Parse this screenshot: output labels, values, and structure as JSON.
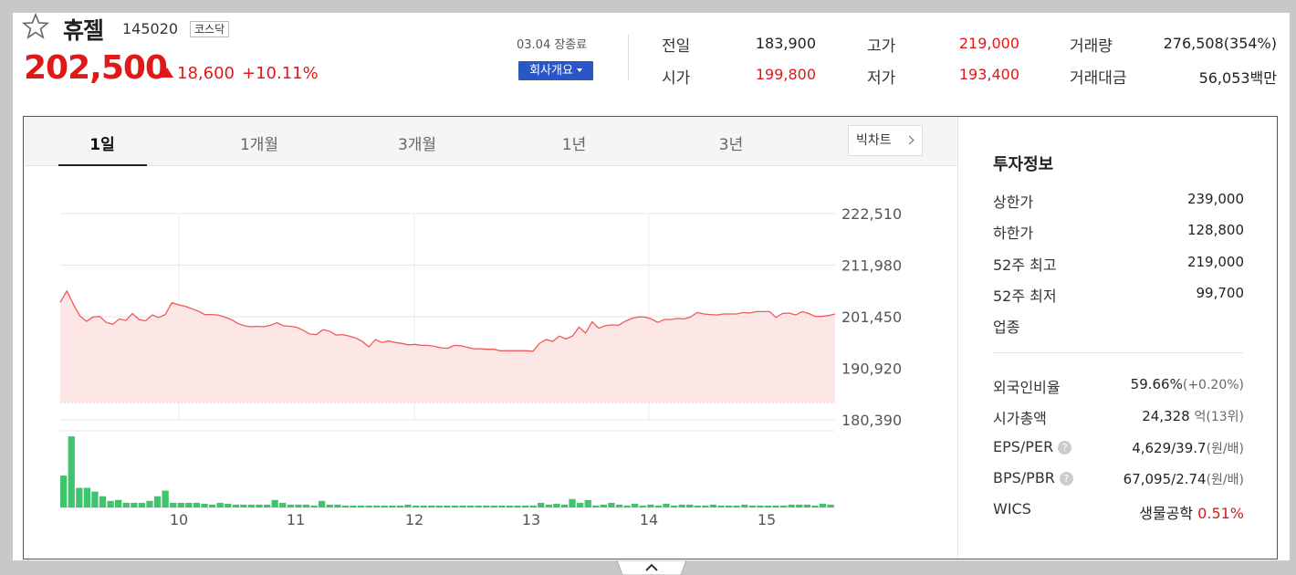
{
  "stock": {
    "name": "휴젤",
    "code": "145020",
    "market": "코스닥",
    "price": "202,500",
    "change": "18,600",
    "change_pct": "+10.11%",
    "date_status": "03.04 장종료",
    "company_button": "회사개요"
  },
  "quotes": [
    {
      "label": "전일",
      "value": "183,900"
    },
    {
      "label": "고가",
      "value": "219,000"
    },
    {
      "label": "거래량",
      "value": "276,508(354%)"
    },
    {
      "label": "시가",
      "value": "199,800"
    },
    {
      "label": "저가",
      "value": "193,400"
    },
    {
      "label": "거래대금",
      "value": "56,053백만"
    }
  ],
  "tabs": [
    "1일",
    "1개월",
    "3개월",
    "1년",
    "3년"
  ],
  "bigchart_label": "빅차트",
  "colors": {
    "up": "#e01818",
    "down": "#2a56c6",
    "volume": "#3ec46d",
    "line": "#ef5a5a",
    "area": "#fde6e6"
  },
  "chart_data": {
    "type": "area",
    "ylim": [
      180390,
      222510
    ],
    "yticks": [
      "222,510",
      "211,980",
      "201,450",
      "190,920",
      "180,390"
    ],
    "xticks": [
      "10",
      "11",
      "12",
      "13",
      "14",
      "15"
    ],
    "price": [
      204400,
      206700,
      204000,
      201600,
      200500,
      201400,
      201500,
      200300,
      199900,
      201000,
      200700,
      202100,
      200900,
      200600,
      201800,
      201300,
      201900,
      204300,
      203900,
      203600,
      203100,
      202600,
      201900,
      201900,
      201800,
      201400,
      200900,
      200100,
      199600,
      199400,
      199500,
      199400,
      199700,
      200200,
      199600,
      199500,
      199300,
      198700,
      197900,
      197800,
      198800,
      198500,
      197700,
      197800,
      197500,
      197100,
      196400,
      195300,
      196800,
      196200,
      196500,
      196200,
      196000,
      195700,
      195800,
      195600,
      195600,
      195400,
      195100,
      195000,
      195600,
      195500,
      195200,
      194900,
      194900,
      194800,
      194800,
      194500,
      194500,
      194500,
      194500,
      194500,
      194400,
      196000,
      196800,
      196400,
      197500,
      196900,
      197500,
      199300,
      198100,
      200400,
      199100,
      199600,
      199800,
      199700,
      200500,
      201100,
      201400,
      201400,
      201000,
      200300,
      200900,
      200900,
      201100,
      201000,
      201400,
      202300,
      202000,
      201900,
      201800,
      202000,
      202000,
      202000,
      202300,
      202200,
      202500,
      202500,
      202500,
      201300,
      202100,
      202200,
      201800,
      202500,
      202100,
      201500,
      201500,
      201700,
      202000
    ],
    "volume": [
      34,
      76,
      21,
      21,
      17,
      12,
      7,
      8,
      5,
      5,
      5,
      7,
      12,
      18,
      5,
      5,
      5,
      5,
      4,
      3,
      5,
      4,
      3,
      3,
      3,
      3,
      3,
      8,
      5,
      3,
      3,
      3,
      2,
      7,
      3,
      3,
      2,
      2,
      2,
      2,
      2,
      2,
      2,
      2,
      3,
      2,
      2,
      2,
      2,
      2,
      2,
      2,
      2,
      2,
      2,
      2,
      2,
      2,
      2,
      2,
      2,
      5,
      3,
      4,
      3,
      9,
      5,
      8,
      2,
      3,
      5,
      3,
      2,
      4,
      2,
      3,
      2,
      4,
      2,
      3,
      3,
      2,
      2,
      3,
      2,
      2,
      2,
      3,
      2,
      2,
      2,
      2,
      2,
      3,
      3,
      3,
      2,
      4,
      3
    ]
  },
  "invest": {
    "title": "투자정보",
    "rows_top": [
      {
        "label": "상한가",
        "value": "239,000"
      },
      {
        "label": "하한가",
        "value": "128,800"
      },
      {
        "label": "52주 최고",
        "value": "219,000"
      },
      {
        "label": "52주 최저",
        "value": "99,700"
      },
      {
        "label": "업종",
        "value": ""
      }
    ],
    "foreign": {
      "label": "외국인비율",
      "value": "59.66%",
      "sub": "(+0.20%)"
    },
    "mktcap": {
      "label": "시가총액",
      "value": "24,328",
      "sub": "억(13위)"
    },
    "eps": {
      "label": "EPS/PER",
      "value": "4,629/39.7",
      "sub": "(원/배)"
    },
    "bps": {
      "label": "BPS/PBR",
      "value": "67,095/2.74",
      "sub": "(원/배)"
    },
    "wics": {
      "label": "WICS",
      "sector": "생물공학",
      "pct": "0.51%"
    }
  }
}
